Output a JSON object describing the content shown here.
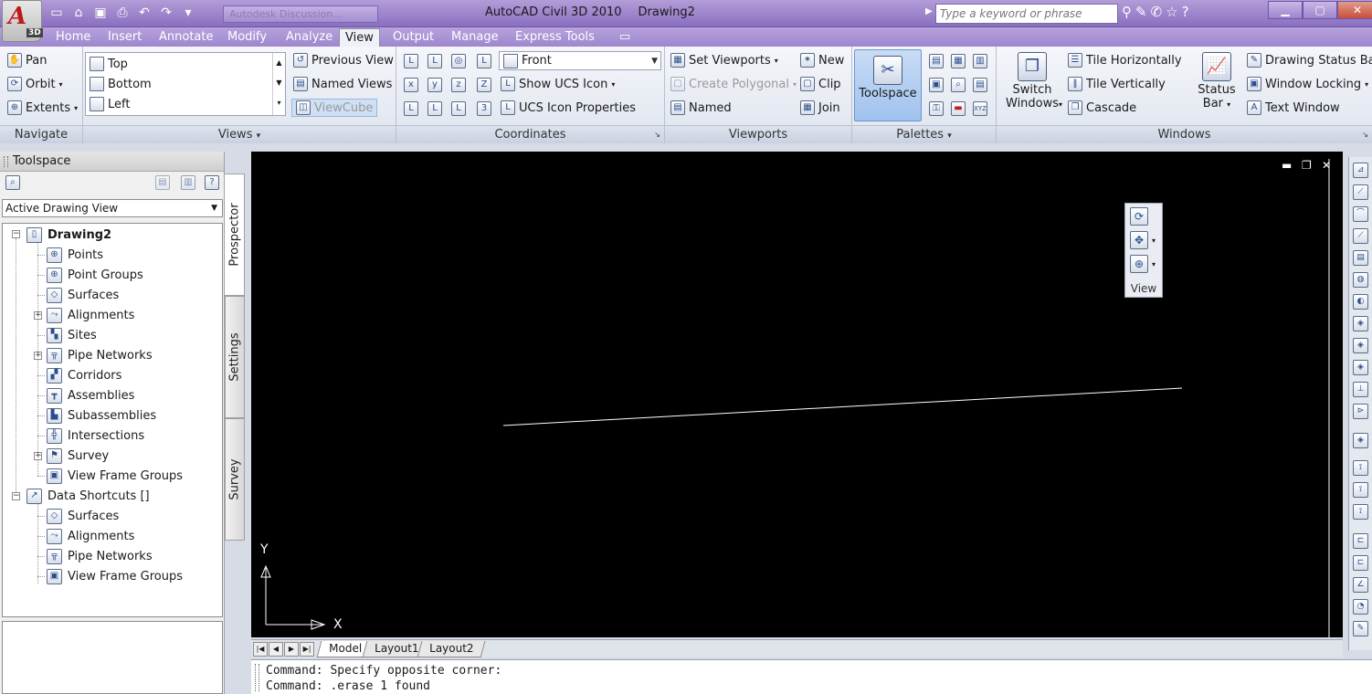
{
  "titlebar": {
    "app_logo": "A",
    "app_badge": "3D",
    "qat_field": "Autodesk Discussion...",
    "app_name": "AutoCAD Civil 3D 2010",
    "document": "Drawing2",
    "search_placeholder": "Type a keyword or phrase"
  },
  "tabs": [
    {
      "label": "Home"
    },
    {
      "label": "Insert"
    },
    {
      "label": "Annotate"
    },
    {
      "label": "Modify"
    },
    {
      "label": "Analyze"
    },
    {
      "label": "View"
    },
    {
      "label": "Output"
    },
    {
      "label": "Manage"
    },
    {
      "label": "Express Tools"
    }
  ],
  "ribbon": {
    "navigate": {
      "title": "Navigate",
      "pan": "Pan",
      "orbit": "Orbit",
      "extents": "Extents"
    },
    "views": {
      "title": "Views",
      "list": [
        "Top",
        "Bottom",
        "Left"
      ],
      "previous_view": "Previous View",
      "named_views": "Named Views",
      "viewcube": "ViewCube"
    },
    "coordinates": {
      "title": "Coordinates",
      "front": "Front",
      "show_ucs_icon": "Show UCS Icon",
      "ucs_icon_properties": "UCS Icon Properties"
    },
    "viewports": {
      "title": "Viewports",
      "set_viewports": "Set Viewports",
      "create_polygonal": "Create Polygonal",
      "named": "Named",
      "new": "New",
      "clip": "Clip",
      "join": "Join"
    },
    "palettes": {
      "title": "Palettes",
      "toolspace": "Toolspace"
    },
    "windows": {
      "title": "Windows",
      "switch_windows_1": "Switch",
      "switch_windows_2": "Windows",
      "tile_horizontally": "Tile Horizontally",
      "tile_vertically": "Tile Vertically",
      "cascade": "Cascade",
      "status_bar_1": "Status",
      "status_bar_2": "Bar",
      "drawing_status_bar": "Drawing Status Bar",
      "window_locking": "Window Locking",
      "text_window": "Text Window"
    }
  },
  "toolspace": {
    "title": "Toolspace",
    "view_select": "Active Drawing View",
    "tree": [
      {
        "label": "Drawing2",
        "icon": "drawing-icon"
      },
      {
        "label": "Points",
        "icon": "points-icon"
      },
      {
        "label": "Point Groups",
        "icon": "point-groups-icon"
      },
      {
        "label": "Surfaces",
        "icon": "surfaces-icon"
      },
      {
        "label": "Alignments",
        "icon": "alignments-icon"
      },
      {
        "label": "Sites",
        "icon": "sites-icon"
      },
      {
        "label": "Pipe Networks",
        "icon": "pipe-networks-icon"
      },
      {
        "label": "Corridors",
        "icon": "corridors-icon"
      },
      {
        "label": "Assemblies",
        "icon": "assemblies-icon"
      },
      {
        "label": "Subassemblies",
        "icon": "subassemblies-icon"
      },
      {
        "label": "Intersections",
        "icon": "intersections-icon"
      },
      {
        "label": "Survey",
        "icon": "survey-icon"
      },
      {
        "label": "View Frame Groups",
        "icon": "view-frame-groups-icon"
      },
      {
        "label": "Data Shortcuts []",
        "icon": "data-shortcuts-icon"
      },
      {
        "label": "Surfaces",
        "icon": "surfaces-icon"
      },
      {
        "label": "Alignments",
        "icon": "alignments-icon"
      },
      {
        "label": "Pipe Networks",
        "icon": "pipe-networks-icon"
      },
      {
        "label": "View Frame Groups",
        "icon": "view-frame-groups-icon"
      }
    ],
    "side_tabs": [
      "Prospector",
      "Settings",
      "Survey"
    ]
  },
  "canvas": {
    "background": "#000000",
    "navbar_label": "View",
    "ucs_x": "X",
    "ucs_y": "Y"
  },
  "layout_tabs": [
    "Model",
    "Layout1",
    "Layout2"
  ],
  "command_line": [
    "Command: Specify opposite corner:",
    "Command:  .erase 1 found"
  ]
}
